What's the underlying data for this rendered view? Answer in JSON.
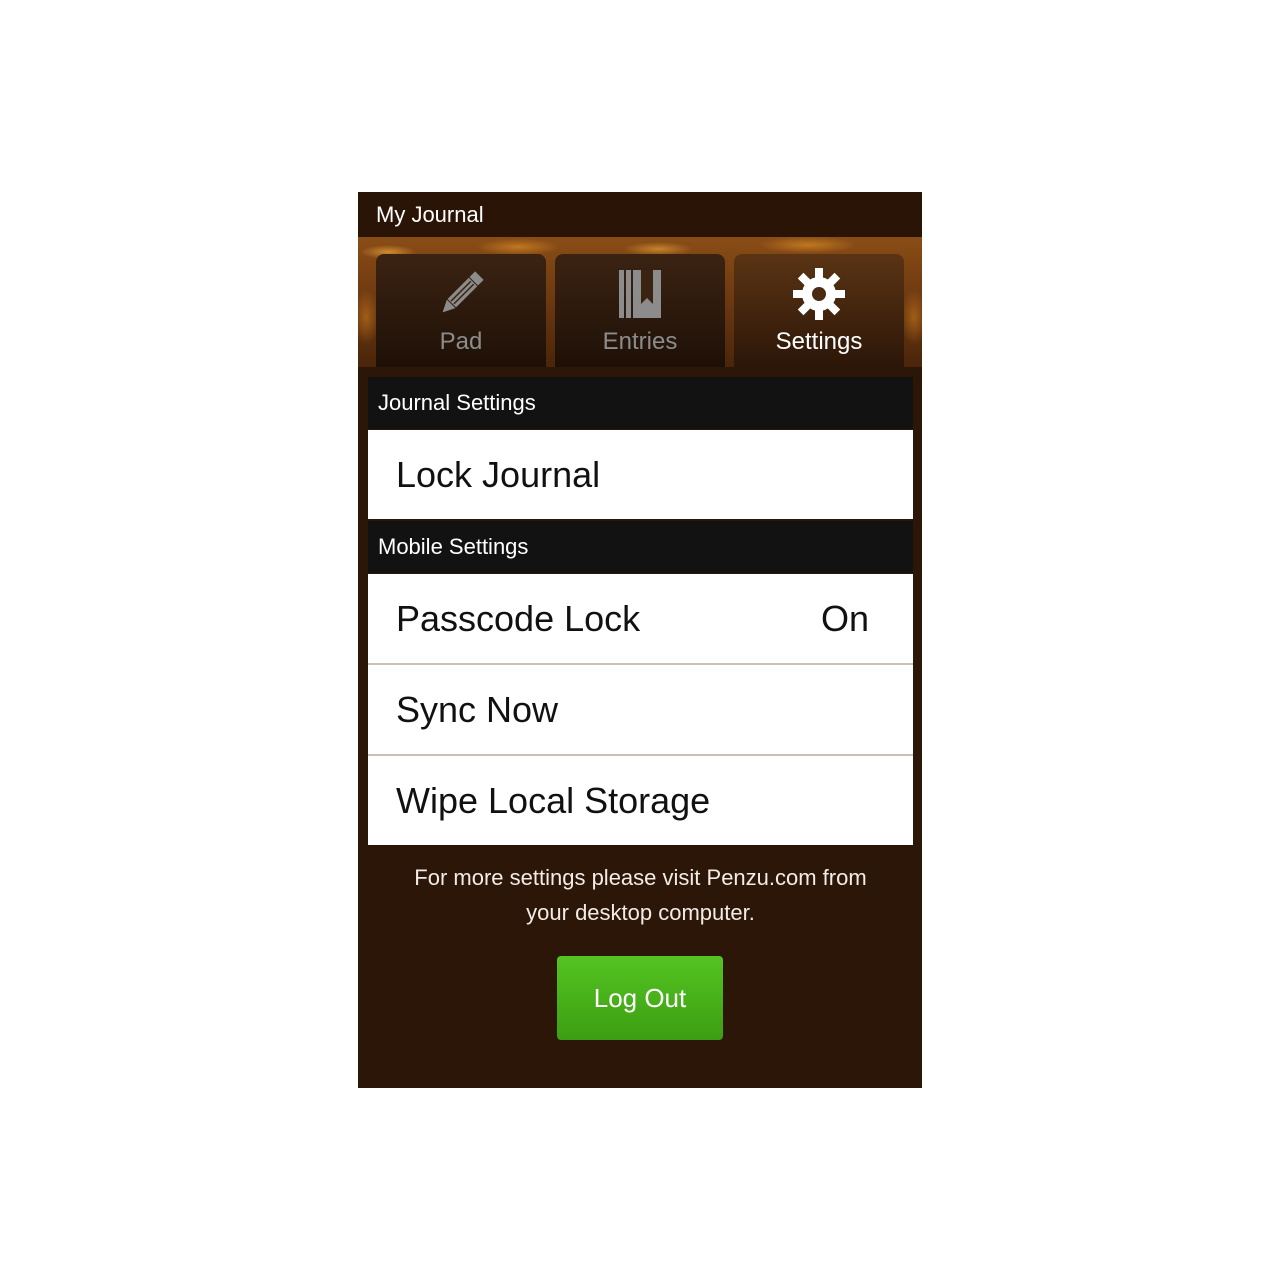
{
  "app": {
    "title": "My Journal"
  },
  "tabs": [
    {
      "label": "Pad",
      "icon": "pencil-icon",
      "active": false
    },
    {
      "label": "Entries",
      "icon": "books-icon",
      "active": false
    },
    {
      "label": "Settings",
      "icon": "gear-icon",
      "active": true
    }
  ],
  "sections": {
    "journal": {
      "header": "Journal Settings",
      "items": [
        {
          "label": "Lock Journal"
        }
      ]
    },
    "mobile": {
      "header": "Mobile Settings",
      "items": [
        {
          "label": "Passcode Lock",
          "value": "On"
        },
        {
          "label": "Sync Now"
        },
        {
          "label": "Wipe Local Storage"
        }
      ]
    }
  },
  "footer": {
    "note_line1": "For more settings please visit Penzu.com from",
    "note_line2": "your desktop computer.",
    "logout_label": "Log Out"
  },
  "colors": {
    "background": "#2c1608",
    "section_header": "#121212",
    "logout_button": "#48b31a",
    "active_tab_text": "#ffffff",
    "inactive_tab_text": "#8c8c8c"
  }
}
